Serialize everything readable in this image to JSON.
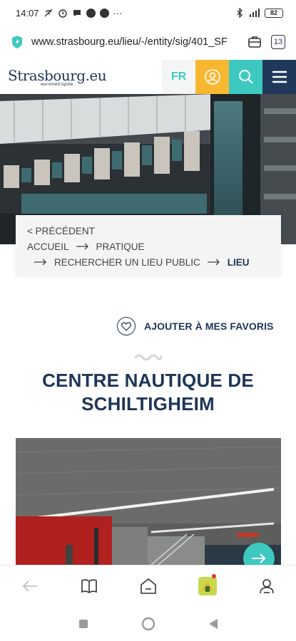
{
  "status_bar": {
    "time": "14:07",
    "dots": "···",
    "battery": "82"
  },
  "url_bar": {
    "url": "www.strasbourg.eu/lieu/-/entity/sig/401_SF",
    "tabs_count": "13"
  },
  "header": {
    "logo_main": "Strasbourg.eu",
    "logo_sub": "eurométropole",
    "lang": "FR",
    "colors": {
      "user_bg": "#f7b731",
      "search_bg": "#3ec9c0",
      "menu_bg": "#20395b",
      "lang_text": "#3ec9c0"
    }
  },
  "breadcrumb": {
    "previous": "< PRÉCÉDENT",
    "items": [
      "ACCUEIL",
      "PRATIQUE",
      "RECHERCHER UN LIEU PUBLIC",
      "LIEU"
    ]
  },
  "favorites": {
    "label": "AJOUTER À MES FAVORIS"
  },
  "page": {
    "title": "CENTRE NAUTIQUE DE SCHILTIGHEIM",
    "title_color": "#1d3557"
  },
  "toolbar": {
    "icons": [
      "back-arrow-icon",
      "book-icon",
      "home-icon",
      "app-icon",
      "profile-icon"
    ]
  }
}
